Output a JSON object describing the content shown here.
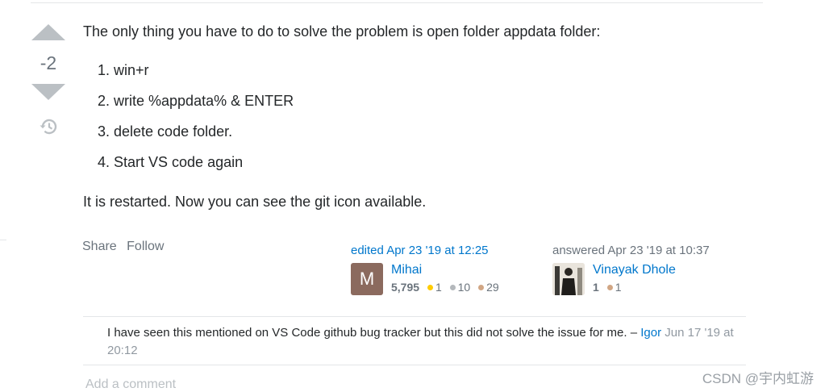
{
  "vote": {
    "count": "-2",
    "up_icon": "arrow-up-icon",
    "down_icon": "arrow-down-icon",
    "history_icon": "history-icon"
  },
  "post": {
    "intro": "The only thing you have to do to solve the problem is open folder appdata folder:",
    "steps": [
      "1. win+r",
      "2. write %appdata% & ENTER",
      "3. delete code folder.",
      "4. Start VS code again"
    ],
    "outro": "It is restarted. Now you can see the git icon available."
  },
  "menu": {
    "share": "Share",
    "follow": "Follow"
  },
  "editor": {
    "action": "edited Apr 23 '19 at 12:25",
    "avatar_letter": "M",
    "name": "Mihai",
    "reputation": "5,795",
    "gold": "1",
    "silver": "10",
    "bronze": "29"
  },
  "author": {
    "action": "answered Apr 23 '19 at 10:37",
    "name": "Vinayak Dhole",
    "reputation": "1",
    "bronze": "1"
  },
  "comment": {
    "text": "I have seen this mentioned on VS Code github bug tracker but this did not solve the issue for me. – ",
    "author": "Igor",
    "date": " Jun 17 '19 at 20:12"
  },
  "add_comment": "Add a comment",
  "watermark": "CSDN @宇内虹游",
  "colors": {
    "link": "#0077cc",
    "muted": "#6a737c",
    "vote_arrow": "#bbc0c4",
    "gold": "#ffcc01",
    "silver": "#b4b8bc",
    "bronze": "#d1a684"
  }
}
